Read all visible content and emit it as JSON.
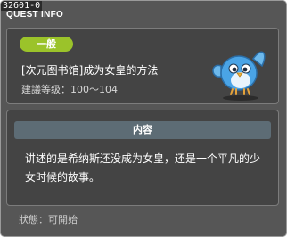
{
  "window": {
    "id_label": "32601-0",
    "title": "QUEST INFO"
  },
  "quest": {
    "grade": "一般",
    "title": "[次元图书馆]成为女皇的方法",
    "level_range": "建議等级：100～104",
    "icon": "blue-bird-icon"
  },
  "content": {
    "header": "内容",
    "text": "讲述的是希纳斯还没成为女皇，还是一个平凡的少女时候的故事。"
  },
  "status": {
    "label": "狀態：可開始"
  },
  "colors": {
    "grade_badge": "#9bc32a",
    "panel_bg": "#444444",
    "window_bg": "#565656",
    "content_header_bg": "#5d6c75"
  }
}
